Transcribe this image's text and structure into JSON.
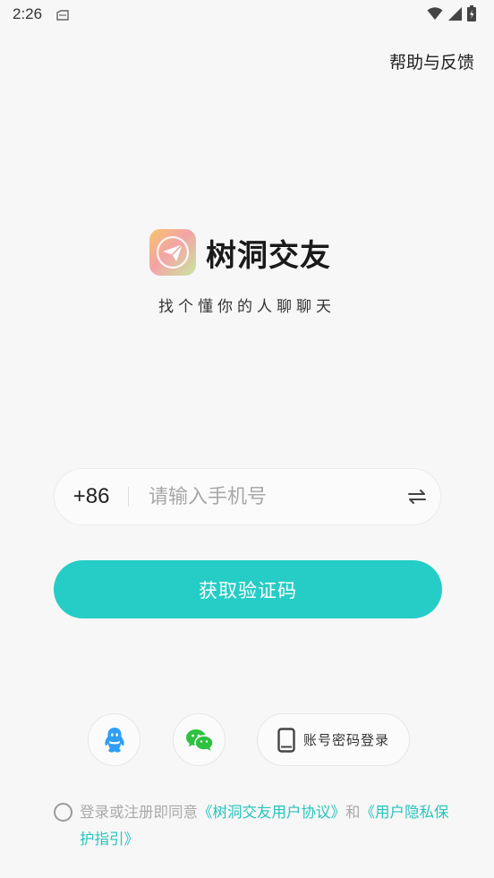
{
  "status_bar": {
    "time": "2:26"
  },
  "header": {
    "help_label": "帮助与反馈"
  },
  "brand": {
    "app_name": "树洞交友",
    "slogan": "找个懂你的人聊聊天"
  },
  "login_form": {
    "country_code": "+86",
    "phone_placeholder": "请输入手机号",
    "phone_value": "",
    "get_code_label": "获取验证码"
  },
  "alt_login": {
    "qq_icon": "qq-icon",
    "wechat_icon": "wechat-icon",
    "password_login_label": "账号密码登录"
  },
  "agreement": {
    "prefix": "登录或注册即同意",
    "user_agreement": "《树洞交友用户协议》",
    "conjunction": "和",
    "privacy_policy": "《用户隐私保护指引》",
    "checked": false
  },
  "colors": {
    "accent": "#26cdc6",
    "link": "#26c4be",
    "background": "#f7f7f7"
  }
}
